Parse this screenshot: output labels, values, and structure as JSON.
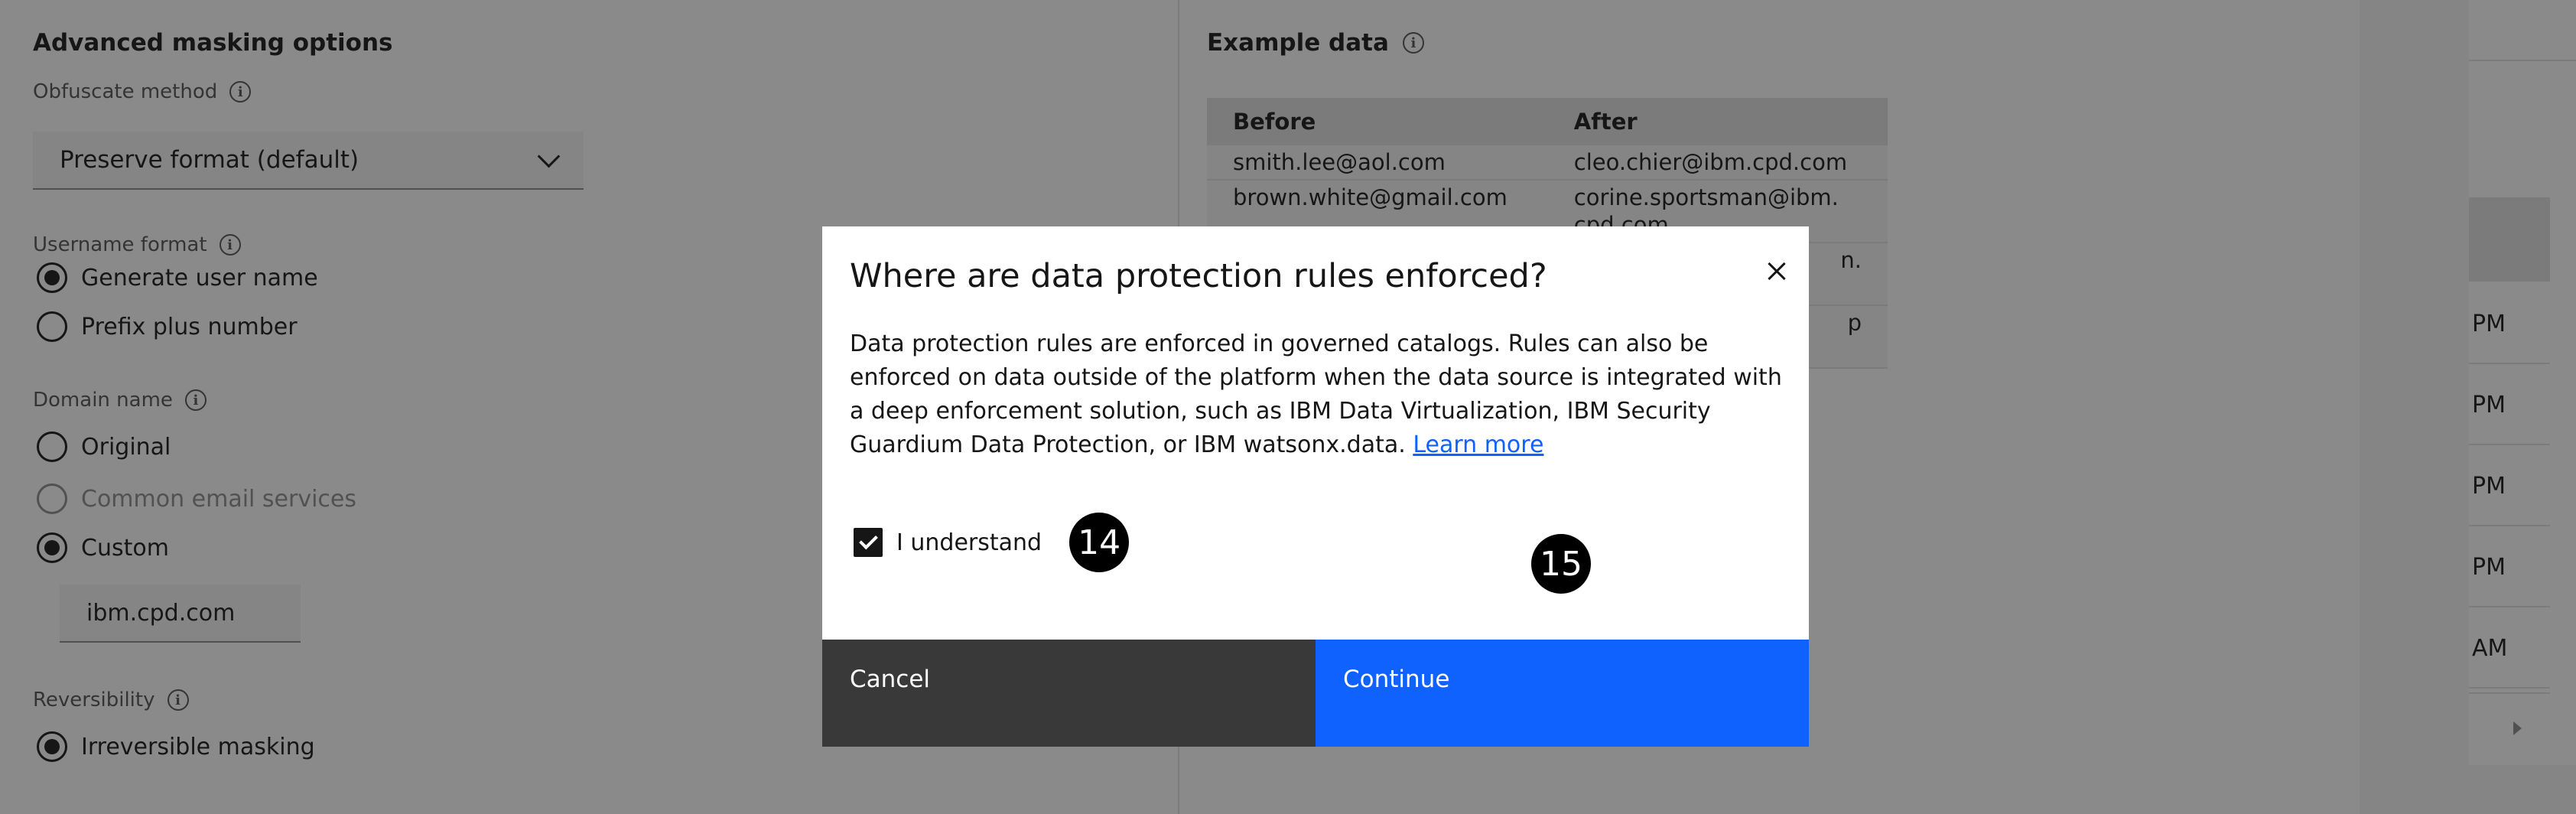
{
  "left_pane": {
    "title": "Advanced masking options",
    "obfuscate_label": "Obfuscate method",
    "obfuscate_value": "Preserve format (default)",
    "username_label": "Username format",
    "username_options": [
      "Generate user name",
      "Prefix plus number"
    ],
    "domain_label": "Domain name",
    "domain_options": [
      "Original",
      "Common email services",
      "Custom"
    ],
    "custom_domain_value": "ibm.cpd.com",
    "reversibility_label": "Reversibility",
    "reversibility_options": [
      "Irreversible masking"
    ],
    "info_icon": "i"
  },
  "example": {
    "title": "Example data",
    "headers": [
      "Before",
      "After"
    ],
    "rows": [
      [
        "smith.lee@aol.com",
        "cleo.chier@ibm.cpd.com"
      ],
      [
        "brown.white@gmail.com",
        "corine.sportsman@ibm.\ncpd.com"
      ],
      [
        "",
        "n."
      ],
      [
        "",
        "p"
      ]
    ]
  },
  "right_strip": {
    "times": [
      "PM",
      "PM",
      "PM",
      "PM",
      "AM"
    ]
  },
  "modal": {
    "title": "Where are data protection rules enforced?",
    "body": "Data protection rules are enforced in governed catalogs. Rules can also be enforced on data outside of the platform when the data source is integrated with a deep enforcement solution, such as IBM Data Virtualization, IBM Security Guardium Data Protection, or IBM watsonx.data. ",
    "link": "Learn more",
    "checkbox_label": "I understand",
    "cancel_label": "Cancel",
    "continue_label": "Continue"
  },
  "annotations": {
    "badge_a": "14",
    "badge_b": "15"
  }
}
